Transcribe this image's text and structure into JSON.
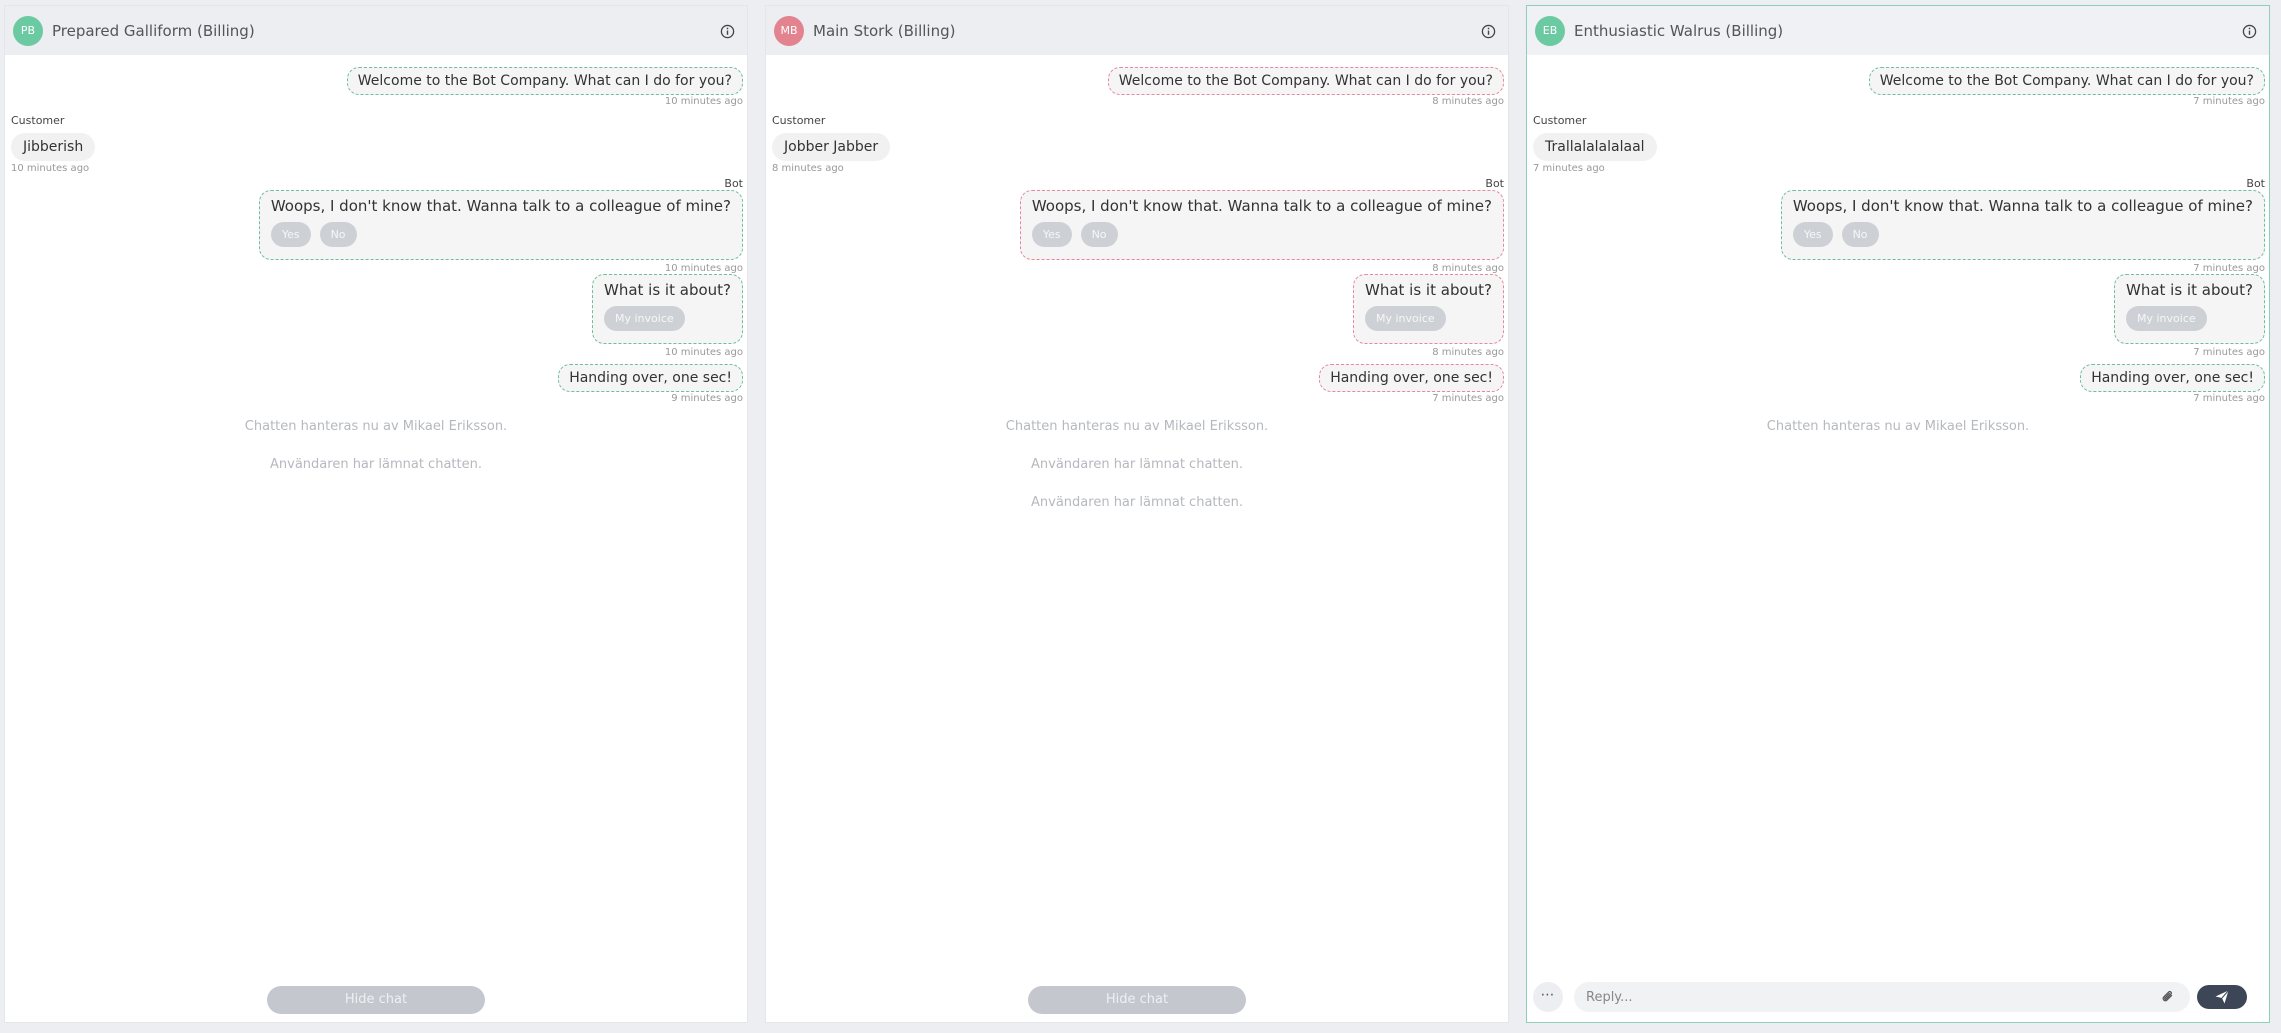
{
  "colors": {
    "avatar_green": "#6ccaa2",
    "avatar_red": "#e38390",
    "bubble_green_border": "#6fbf98",
    "bubble_red_border": "#e8889a"
  },
  "chats": [
    {
      "initials": "PB",
      "title": "Prepared Galliform (Billing)",
      "welcome": {
        "text": "Welcome to the Bot Company. What can I do for you?",
        "time": "10 minutes ago"
      },
      "customer": {
        "label": "Customer",
        "text": "Jibberish",
        "time": "10 minutes ago"
      },
      "bot_label": "Bot",
      "fallback": {
        "text": "Woops, I don't know that. Wanna talk to a colleague of mine?",
        "yes": "Yes",
        "no": "No",
        "time": "10 minutes ago"
      },
      "about": {
        "text": "What is it about?",
        "option": "My invoice",
        "time": "10 minutes ago"
      },
      "handover": {
        "text": "Handing over, one sec!",
        "time": "9 minutes ago"
      },
      "system": [
        "Chatten hanteras nu av Mikael Eriksson.",
        "Användaren har lämnat chatten."
      ],
      "hide_label": "Hide chat"
    },
    {
      "initials": "MB",
      "title": "Main Stork (Billing)",
      "welcome": {
        "text": "Welcome to the Bot Company. What can I do for you?",
        "time": "8 minutes ago"
      },
      "customer": {
        "label": "Customer",
        "text": "Jobber Jabber",
        "time": "8 minutes ago"
      },
      "bot_label": "Bot",
      "fallback": {
        "text": "Woops, I don't know that. Wanna talk to a colleague of mine?",
        "yes": "Yes",
        "no": "No",
        "time": "8 minutes ago"
      },
      "about": {
        "text": "What is it about?",
        "option": "My invoice",
        "time": "8 minutes ago"
      },
      "handover": {
        "text": "Handing over, one sec!",
        "time": "7 minutes ago"
      },
      "system": [
        "Chatten hanteras nu av Mikael Eriksson.",
        "Användaren har lämnat chatten.",
        "Användaren har lämnat chatten."
      ],
      "hide_label": "Hide chat"
    },
    {
      "initials": "EB",
      "title": "Enthusiastic Walrus (Billing)",
      "welcome": {
        "text": "Welcome to the Bot Company. What can I do for you?",
        "time": "7 minutes ago"
      },
      "customer": {
        "label": "Customer",
        "text": "Trallalalalalaal",
        "time": "7 minutes ago"
      },
      "bot_label": "Bot",
      "fallback": {
        "text": "Woops, I don't know that. Wanna talk to a colleague of mine?",
        "yes": "Yes",
        "no": "No",
        "time": "7 minutes ago"
      },
      "about": {
        "text": "What is it about?",
        "option": "My invoice",
        "time": "7 minutes ago"
      },
      "handover": {
        "text": "Handing over, one sec!",
        "time": "7 minutes ago"
      },
      "system": [
        "Chatten hanteras nu av Mikael Eriksson."
      ],
      "reply_placeholder": "Reply...",
      "more_icon": "more-horizontal-icon",
      "attach_icon": "paperclip-icon",
      "send_icon": "paper-plane-icon"
    }
  ]
}
